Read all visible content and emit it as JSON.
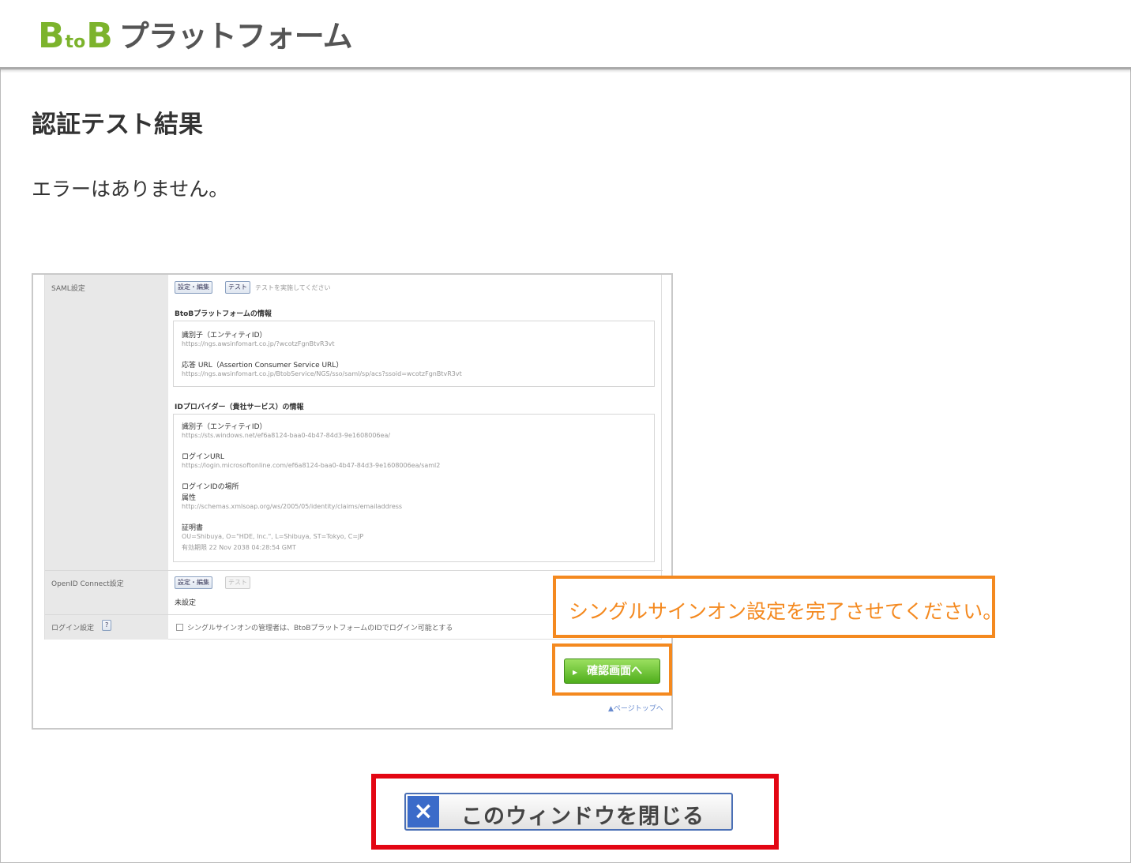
{
  "header": {
    "logo_b1": "B",
    "logo_to": "to",
    "logo_b2": "B",
    "logo_text": "プラットフォーム"
  },
  "main": {
    "title": "認証テスト結果",
    "result_message": "エラーはありません。"
  },
  "embedded_screenshot": {
    "saml_label": "SAML設定",
    "edit_button": "設定・編集",
    "test_button": "テスト",
    "test_hint": "テストを実施してください",
    "btob_info_heading": "BtoBプラットフォームの情報",
    "btob_entity_label": "識別子（エンティティID）",
    "btob_entity_value": "https://ngs.awsinfomart.co.jp/?wcotzFgnBtvR3vt",
    "btob_acs_label": "応答 URL（Assertion Consumer Service URL）",
    "btob_acs_value": "https://ngs.awsinfomart.co.jp/BtobService/NGS/sso/saml/sp/acs?ssoid=wcotzFgnBtvR3vt",
    "idp_heading": "IDプロバイダー（貴社サービス）の情報",
    "idp_entity_label": "識別子（エンティティID）",
    "idp_entity_value": "https://sts.windows.net/ef6a8124-baa0-4b47-84d3-9e1608006ea/",
    "idp_login_label": "ログインURL",
    "idp_login_value": "https://login.microsoftonline.com/ef6a8124-baa0-4b47-84d3-9e1608006ea/saml2",
    "idp_loginid_label": "ログインIDの場所",
    "idp_attr_label": "属性",
    "idp_attr_value": "http://schemas.xmlsoap.org/ws/2005/05/identity/claims/emailaddress",
    "cert_label": "証明書",
    "cert_value": "OU=Shibuya, O=\"HDE, Inc.\", L=Shibuya, ST=Tokyo, C=JP",
    "cert_expiry": "有効期限 22 Nov 2038 04:28:54 GMT",
    "openid_label": "OpenID Connect設定",
    "openid_edit_button": "設定・編集",
    "openid_test_button": "テスト",
    "openid_status": "未設定",
    "login_setting_label": "ログイン設定",
    "login_setting_help": "?",
    "login_setting_checkbox_text": "シングルサインオンの管理者は、BtoBプラットフォームのIDでログイン可能とする",
    "confirm_button": "確認画面へ",
    "page_top_link": "▲ページトップへ"
  },
  "callout": {
    "message": "シングルサインオン設定を完了させてください。"
  },
  "footer": {
    "close_icon": "×",
    "close_label": "このウィンドウを閉じる"
  },
  "colors": {
    "logo_green": "#7cb32c",
    "highlight_orange": "#f4891f",
    "highlight_red": "#e30613",
    "button_blue": "#3b6bc9"
  }
}
